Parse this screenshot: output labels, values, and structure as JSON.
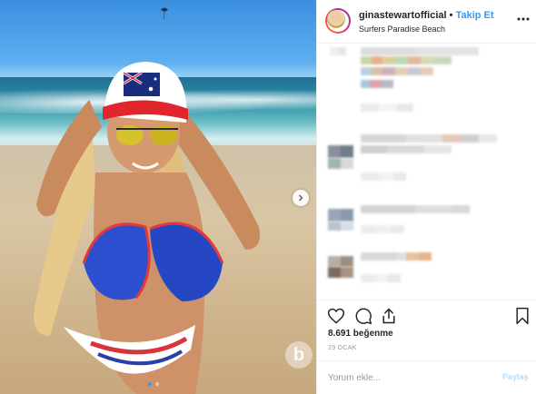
{
  "post": {
    "username": "ginastewartofficial",
    "separator": "•",
    "follow_label": "Takip Et",
    "location": "Surfers Paradise Beach"
  },
  "icons": {
    "more": "more-options-icon",
    "like": "heart-icon",
    "comment": "comment-bubble-icon",
    "share": "share-icon",
    "save": "bookmark-icon",
    "next": "chevron-right-icon"
  },
  "stats": {
    "likes": "8.691 beğenme",
    "date": "29 OCAK"
  },
  "comment_box": {
    "placeholder": "Yorum ekle...",
    "share_label": "Paylaş"
  },
  "carousel": {
    "total_images": 2,
    "current_image": 1
  },
  "colors": {
    "accent": "#3897f0",
    "share_disabled": "#b2dffc"
  }
}
